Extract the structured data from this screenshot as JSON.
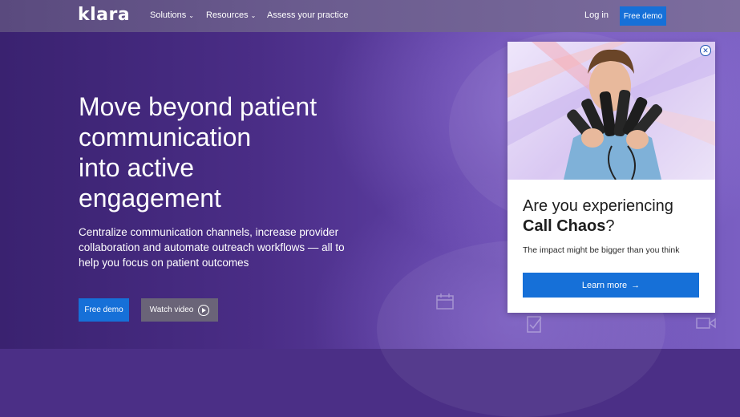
{
  "nav": {
    "logo": "klara",
    "items": [
      {
        "label": "Solutions",
        "has_dropdown": true
      },
      {
        "label": "Resources",
        "has_dropdown": true
      },
      {
        "label": "Assess your practice",
        "has_dropdown": false
      }
    ],
    "login": "Log in",
    "demo": "Free demo"
  },
  "hero": {
    "headline_lines": [
      "Move beyond patient",
      "communication",
      "into active",
      "engagement"
    ],
    "subhead_lines": [
      "Centralize communication channels, increase provider",
      "collaboration and automate outreach workflows — all to",
      "help you focus on patient outcomes"
    ],
    "cta_primary": "Free demo",
    "cta_secondary": "Watch video"
  },
  "popup": {
    "title_line1": "Are you experiencing",
    "title_bold": "Call Chaos",
    "title_suffix": "?",
    "text": "The impact might be bigger than you think",
    "button": "Learn more",
    "close_icon": "close-circle-icon"
  },
  "colors": {
    "accent": "#1670d8",
    "hero_bg": "#4b2f86",
    "secondary_button": "#6a6478"
  }
}
